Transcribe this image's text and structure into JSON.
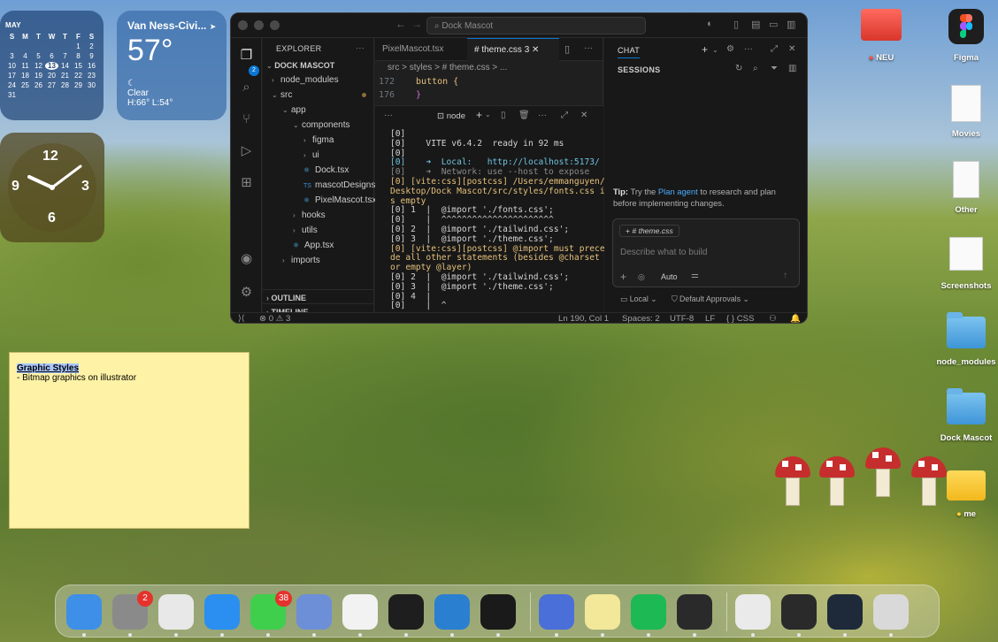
{
  "calendar": {
    "month": "MAY",
    "day_names": [
      "S",
      "M",
      "T",
      "W",
      "T",
      "F",
      "S"
    ],
    "weeks": [
      [
        "",
        "",
        "",
        "",
        "",
        "1",
        "2"
      ],
      [
        "3",
        "4",
        "5",
        "6",
        "7",
        "8",
        "9"
      ],
      [
        "10",
        "11",
        "12",
        "13",
        "14",
        "15",
        "16"
      ],
      [
        "17",
        "18",
        "19",
        "20",
        "21",
        "22",
        "23"
      ],
      [
        "24",
        "25",
        "26",
        "27",
        "28",
        "29",
        "30"
      ],
      [
        "31",
        "",
        "",
        "",
        "",
        "",
        ""
      ]
    ],
    "today": "13"
  },
  "weather": {
    "city": "Van Ness-Civi...",
    "temp": "57°",
    "condition": "Clear",
    "hi_lo": "H:66° L:54°"
  },
  "clock": {
    "n12": "12",
    "n3": "3",
    "n6": "6",
    "n9": "9"
  },
  "vscode": {
    "title_search": "Dock Mascot",
    "activity_badge": "2",
    "explorer": {
      "header": "EXPLORER",
      "project": "DOCK MASCOT",
      "tree": [
        {
          "label": "node_modules",
          "type": "folder",
          "depth": 0,
          "open": false
        },
        {
          "label": "src",
          "type": "folder",
          "depth": 0,
          "open": true
        },
        {
          "label": "app",
          "type": "folder",
          "depth": 1,
          "open": true
        },
        {
          "label": "components",
          "type": "folder",
          "depth": 2,
          "open": true
        },
        {
          "label": "figma",
          "type": "folder",
          "depth": 3,
          "open": false
        },
        {
          "label": "ui",
          "type": "folder",
          "depth": 3,
          "open": false
        },
        {
          "label": "Dock.tsx",
          "type": "react",
          "depth": 3
        },
        {
          "label": "mascotDesigns.ts",
          "type": "ts",
          "depth": 3
        },
        {
          "label": "PixelMascot.tsx",
          "type": "react",
          "depth": 3
        },
        {
          "label": "hooks",
          "type": "folder",
          "depth": 2,
          "open": false
        },
        {
          "label": "utils",
          "type": "folder",
          "depth": 2,
          "open": false
        },
        {
          "label": "App.tsx",
          "type": "react",
          "depth": 2
        },
        {
          "label": "imports",
          "type": "folder",
          "depth": 1,
          "open": false
        }
      ],
      "outline": "OUTLINE",
      "timeline": "TIMELINE"
    },
    "tabs": [
      {
        "label": "PixelMascot.tsx",
        "active": false
      },
      {
        "label": "# theme.css 3",
        "active": true
      }
    ],
    "breadcrumb": "src > styles > # theme.css > ...",
    "code": [
      {
        "line": "172",
        "text": "  button {"
      },
      {
        "line": "176",
        "text": "  }"
      }
    ],
    "terminal": {
      "name": "node",
      "lines": [
        {
          "text": "[0]",
          "color": "#d4d4d4"
        },
        {
          "text": "[0]    VITE v6.4.2  ready in 92 ms",
          "color": "#d4d4d4"
        },
        {
          "text": "[0]",
          "color": "#d4d4d4"
        },
        {
          "text": "[0]    ➜  Local:   http://localhost:5173/",
          "color": "#6fc3df"
        },
        {
          "text": "[0]    ➜  Network: use --host to expose",
          "color": "#8a8a8a"
        },
        {
          "text": "[0] [vite:css][postcss] /Users/emmanguyen/",
          "color": "#e5c07b"
        },
        {
          "text": "Desktop/Dock Mascot/src/styles/fonts.css i",
          "color": "#e5c07b"
        },
        {
          "text": "s empty",
          "color": "#e5c07b"
        },
        {
          "text": "[0] 1  |  @import './fonts.css';",
          "color": "#d4d4d4"
        },
        {
          "text": "[0]    |  ^^^^^^^^^^^^^^^^^^^^^^",
          "color": "#d4d4d4"
        },
        {
          "text": "[0] 2  |  @import './tailwind.css';",
          "color": "#d4d4d4"
        },
        {
          "text": "[0] 3  |  @import './theme.css';",
          "color": "#d4d4d4"
        },
        {
          "text": "[0] [vite:css][postcss] @import must prece",
          "color": "#e5c07b"
        },
        {
          "text": "de all other statements (besides @charset",
          "color": "#e5c07b"
        },
        {
          "text": "or empty @layer)",
          "color": "#e5c07b"
        },
        {
          "text": "[0] 2  |  @import './tailwind.css';",
          "color": "#d4d4d4"
        },
        {
          "text": "[0] 3  |  @import './theme.css';",
          "color": "#d4d4d4"
        },
        {
          "text": "[0] 4  |",
          "color": "#d4d4d4"
        },
        {
          "text": "[0]    |  ^",
          "color": "#d4d4d4"
        },
        {
          "text": "▯",
          "color": "#d4d4d4"
        }
      ]
    },
    "chat": {
      "tab": "CHAT",
      "sessions": "SESSIONS",
      "tip_prefix": "Tip:",
      "tip_text1": " Try the ",
      "tip_link": "Plan agent",
      "tip_text2": " to research and plan before implementing changes.",
      "context_chip": "# theme.css",
      "placeholder": "Describe what to build",
      "mode": "Auto",
      "location": "Local",
      "approvals": "Default Approvals"
    },
    "status": {
      "errors": "0",
      "warnings": "3",
      "position": "Ln 190, Col 1",
      "spaces": "Spaces: 2",
      "encoding": "UTF-8",
      "eol": "LF",
      "language": "{ } CSS"
    }
  },
  "desktop_icons": [
    {
      "label": "NEU",
      "kind": "red-folder"
    },
    {
      "label": "Figma",
      "kind": "figma"
    },
    {
      "label": "Movies",
      "kind": "doc"
    },
    {
      "label": "Other",
      "kind": "doc"
    },
    {
      "label": "Screenshots",
      "kind": "doc"
    },
    {
      "label": "node_modules",
      "kind": "blue-folder"
    },
    {
      "label": "Dock Mascot",
      "kind": "blue-folder"
    },
    {
      "label": "me",
      "kind": "yellow-folder"
    }
  ],
  "sticky": {
    "heading": "Graphic Styles",
    "body": "- Bitmap graphics on illustrator"
  },
  "dock": {
    "apps": [
      {
        "name": "finder",
        "color": "#3d8fe8"
      },
      {
        "name": "system-settings",
        "color": "#8a8a8a",
        "badge": "2"
      },
      {
        "name": "launchpad",
        "color": "#e8e8e8"
      },
      {
        "name": "safari",
        "color": "#2a8ff0"
      },
      {
        "name": "messages",
        "color": "#3fcf4d",
        "badge": "38"
      },
      {
        "name": "simulator",
        "color": "#6d8fd8"
      },
      {
        "name": "chrome",
        "color": "#f2f2f2"
      },
      {
        "name": "figma",
        "color": "#1e1e1e"
      },
      {
        "name": "vscode",
        "color": "#2a7fd0"
      },
      {
        "name": "terminal",
        "color": "#1a1a1a"
      },
      {
        "name": "ai-app",
        "color": "#4a6fd8"
      },
      {
        "name": "notes",
        "color": "#f3e79a"
      },
      {
        "name": "spotify",
        "color": "#1db954"
      },
      {
        "name": "chatgpt",
        "color": "#2a2a2a"
      },
      {
        "name": "downloads",
        "color": "#eaeaea"
      },
      {
        "name": "window-thumb-1",
        "color": "#2a2a2a"
      },
      {
        "name": "window-thumb-2",
        "color": "#1e2a3a"
      },
      {
        "name": "trash",
        "color": "#d9d9d9"
      }
    ]
  }
}
